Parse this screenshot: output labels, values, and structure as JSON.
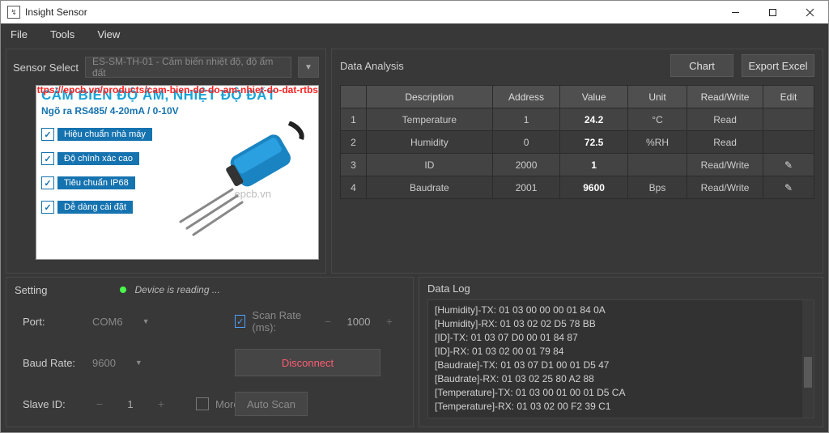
{
  "window": {
    "title": "Insight Sensor"
  },
  "menu": {
    "file": "File",
    "tools": "Tools",
    "view": "View"
  },
  "sensor_select": {
    "label": "Sensor Select",
    "selected": "ES-SM-TH-01 - Cảm biến nhiệt độ, độ ẩm đất"
  },
  "product": {
    "urlish": "tại: https://epcb.vn/products/cam-bien-do-do-am-nhiet-do-dat-rtbs",
    "title": "CẢM BIẾN ĐỘ ẨM, NHIỆT ĐỘ ĐẤT",
    "subtitle": "Ngõ ra RS485/ 4-20mA / 0-10V",
    "features": [
      "Hiệu chuẩn nhà máy",
      "Độ chính xác cao",
      "Tiêu chuẩn IP68",
      "Dễ dàng cài đặt"
    ],
    "watermark": "epcb.vn"
  },
  "data_analysis": {
    "title": "Data Analysis",
    "chart_btn": "Chart",
    "export_btn": "Export Excel",
    "headers": {
      "desc": "Description",
      "addr": "Address",
      "val": "Value",
      "unit": "Unit",
      "rw": "Read/Write",
      "edit": "Edit"
    },
    "rows": [
      {
        "idx": "1",
        "desc": "Temperature",
        "addr": "1",
        "val": "24.2",
        "unit": "°C",
        "rw": "Read",
        "editable": false
      },
      {
        "idx": "2",
        "desc": "Humidity",
        "addr": "0",
        "val": "72.5",
        "unit": "%RH",
        "rw": "Read",
        "editable": false
      },
      {
        "idx": "3",
        "desc": "ID",
        "addr": "2000",
        "val": "1",
        "unit": "",
        "rw": "Read/Write",
        "editable": true
      },
      {
        "idx": "4",
        "desc": "Baudrate",
        "addr": "2001",
        "val": "9600",
        "unit": "Bps",
        "rw": "Read/Write",
        "editable": true
      }
    ]
  },
  "setting": {
    "title": "Setting",
    "status": "Device is reading ...",
    "port_label": "Port:",
    "port_value": "COM6",
    "baud_label": "Baud Rate:",
    "baud_value": "9600",
    "slave_label": "Slave ID:",
    "slave_value": "1",
    "scan_label": "Scan Rate (ms):",
    "scan_value": "1000",
    "disconnect": "Disconnect",
    "more": "More Devices",
    "auto": "Auto Scan"
  },
  "datalog": {
    "title": "Data Log",
    "lines": [
      "[Humidity]-TX: 01 03 00 00 00 01 84 0A",
      "[Humidity]-RX: 01 03 02 02 D5 78 BB",
      "[ID]-TX: 01 03 07 D0 00 01 84 87",
      "[ID]-RX: 01 03 02 00 01 79 84",
      "[Baudrate]-TX: 01 03 07 D1 00 01 D5 47",
      "[Baudrate]-RX: 01 03 02 25 80 A2 88",
      "[Temperature]-TX: 01 03 00 01 00 01 D5 CA",
      "[Temperature]-RX: 01 03 02 00 F2 39 C1"
    ]
  }
}
